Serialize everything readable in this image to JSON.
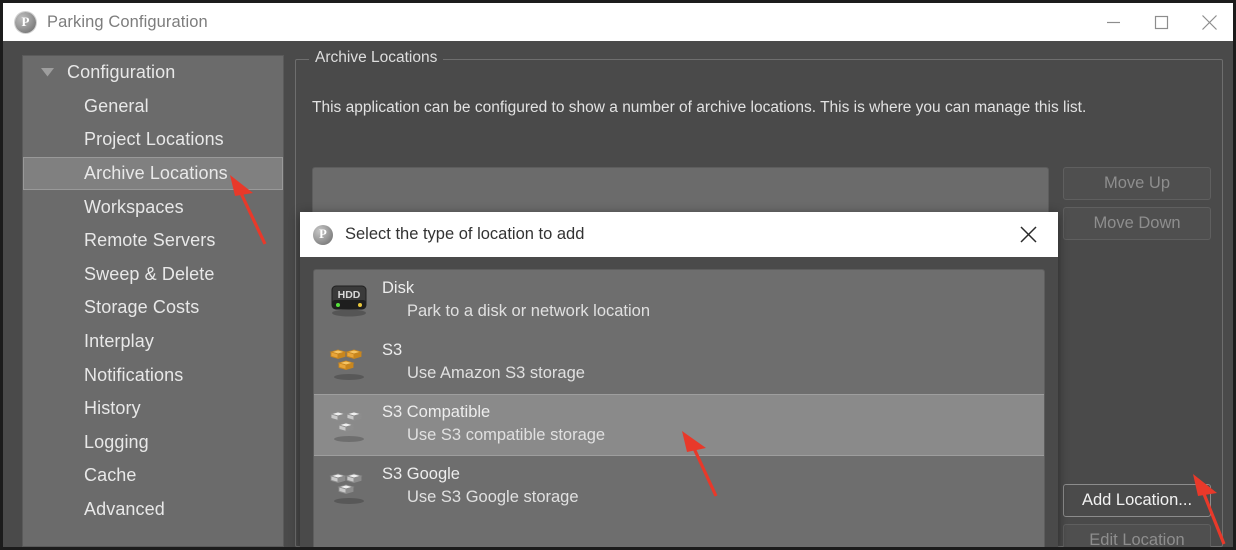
{
  "window": {
    "title": "Parking Configuration",
    "logo_letter": "P",
    "controls": [
      {
        "name": "minimize",
        "glyph": "minimize-icon"
      },
      {
        "name": "maximize",
        "glyph": "maximize-icon"
      },
      {
        "name": "close",
        "glyph": "close-icon"
      }
    ]
  },
  "sidebar": {
    "root": {
      "label": "Configuration",
      "expander": "chevron-down-icon",
      "expanded": true
    },
    "items": [
      {
        "label": "General",
        "selected": false
      },
      {
        "label": "Project Locations",
        "selected": false
      },
      {
        "label": "Archive Locations",
        "selected": true
      },
      {
        "label": "Workspaces",
        "selected": false
      },
      {
        "label": "Remote Servers",
        "selected": false
      },
      {
        "label": "Sweep & Delete",
        "selected": false
      },
      {
        "label": "Storage Costs",
        "selected": false
      },
      {
        "label": "Interplay",
        "selected": false
      },
      {
        "label": "Notifications",
        "selected": false
      },
      {
        "label": "History",
        "selected": false
      },
      {
        "label": "Logging",
        "selected": false
      },
      {
        "label": "Cache",
        "selected": false
      },
      {
        "label": "Advanced",
        "selected": false
      }
    ]
  },
  "main": {
    "groupbox_legend": "Archive Locations",
    "description": "This application can be configured to show a number of archive locations. This is where you can manage this list.",
    "locations": [],
    "buttons": [
      {
        "label": "Move Up",
        "enabled": false
      },
      {
        "label": "Move Down",
        "enabled": false
      },
      {
        "label": "Add Location...",
        "enabled": true
      },
      {
        "label": "Edit Location",
        "enabled": false
      }
    ]
  },
  "dialog": {
    "title": "Select the type of location to add",
    "logo_letter": "P",
    "close_label": "close-icon",
    "types": [
      {
        "title": "Disk",
        "subtitle": "Park to a disk or network location",
        "icon": "hdd-icon",
        "selected": false
      },
      {
        "title": "S3",
        "subtitle": "Use Amazon S3 storage",
        "icon": "s3-amazon-icon",
        "selected": false
      },
      {
        "title": "S3 Compatible",
        "subtitle": "Use S3 compatible storage",
        "icon": "s3-generic-icon",
        "selected": true
      },
      {
        "title": "S3 Google",
        "subtitle": "Use S3 Google storage",
        "icon": "s3-generic-icon",
        "selected": false
      }
    ]
  },
  "annotations": {
    "arrow_color": "#e8392a",
    "arrows": [
      {
        "name": "arrow-to-archive-locations",
        "points_at": "Archive Locations"
      },
      {
        "name": "arrow-to-s3-compatible",
        "points_at": "S3 Compatible"
      },
      {
        "name": "arrow-to-add-location",
        "points_at": "Add Location..."
      }
    ]
  },
  "colors": {
    "window_bg": "#4a4a4a",
    "panel_bg": "#6b6b6b",
    "selection_bg": "#8a8a8a",
    "titlebar_bg": "#ffffff",
    "text": "#e8e8e8",
    "accent_red": "#e8392a"
  }
}
